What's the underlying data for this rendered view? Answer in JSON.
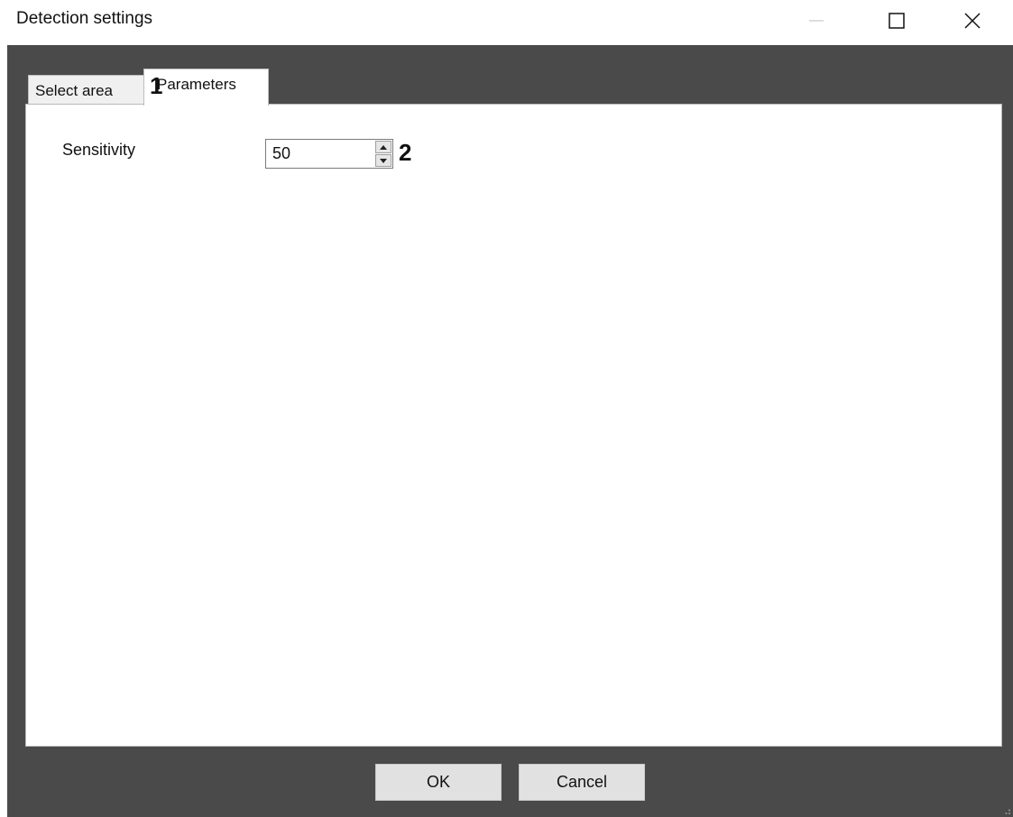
{
  "window": {
    "title": "Detection settings",
    "controls": {
      "minimize_icon": "minimize-icon",
      "maximize_icon": "maximize-icon",
      "close_icon": "close-icon"
    }
  },
  "tabs": [
    {
      "label": "Select area",
      "active": false
    },
    {
      "label": "Parameters",
      "active": true
    }
  ],
  "annotations": {
    "marker_1": "1",
    "marker_2": "2"
  },
  "parameters": {
    "sensitivity_label": "Sensitivity",
    "sensitivity_value": "50"
  },
  "buttons": {
    "ok": "OK",
    "cancel": "Cancel"
  },
  "colors": {
    "client_background": "#4a4a4a",
    "panel_background": "#ffffff",
    "button_background": "#e1e1e1"
  }
}
